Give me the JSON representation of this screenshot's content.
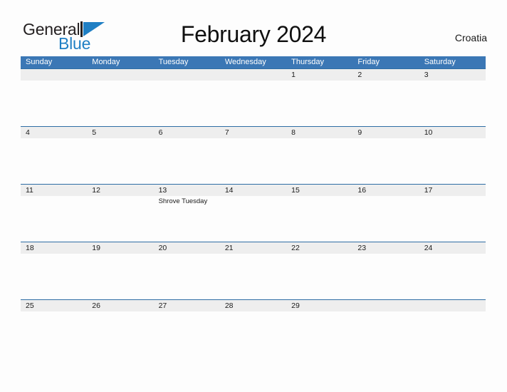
{
  "brand": {
    "name_top": "General",
    "name_bottom": "Blue",
    "flag_icon": "blue-triangle-flag-icon",
    "accent_color": "#1f7fc4"
  },
  "header": {
    "title": "February 2024",
    "country": "Croatia"
  },
  "colors": {
    "header_blue": "#3b77b5",
    "row_line_blue": "#2e6da4",
    "date_band_gray": "#eeeeee",
    "page_background": "#fdfdfd",
    "text": "#1a1a1a"
  },
  "calendar": {
    "month": "February",
    "year": "2024",
    "weekdays": [
      "Sunday",
      "Monday",
      "Tuesday",
      "Wednesday",
      "Thursday",
      "Friday",
      "Saturday"
    ],
    "weeks": [
      {
        "days": [
          {
            "num": "",
            "event": ""
          },
          {
            "num": "",
            "event": ""
          },
          {
            "num": "",
            "event": ""
          },
          {
            "num": "",
            "event": ""
          },
          {
            "num": "1",
            "event": ""
          },
          {
            "num": "2",
            "event": ""
          },
          {
            "num": "3",
            "event": ""
          }
        ]
      },
      {
        "days": [
          {
            "num": "4",
            "event": ""
          },
          {
            "num": "5",
            "event": ""
          },
          {
            "num": "6",
            "event": ""
          },
          {
            "num": "7",
            "event": ""
          },
          {
            "num": "8",
            "event": ""
          },
          {
            "num": "9",
            "event": ""
          },
          {
            "num": "10",
            "event": ""
          }
        ]
      },
      {
        "days": [
          {
            "num": "11",
            "event": ""
          },
          {
            "num": "12",
            "event": ""
          },
          {
            "num": "13",
            "event": "Shrove Tuesday"
          },
          {
            "num": "14",
            "event": ""
          },
          {
            "num": "15",
            "event": ""
          },
          {
            "num": "16",
            "event": ""
          },
          {
            "num": "17",
            "event": ""
          }
        ]
      },
      {
        "days": [
          {
            "num": "18",
            "event": ""
          },
          {
            "num": "19",
            "event": ""
          },
          {
            "num": "20",
            "event": ""
          },
          {
            "num": "21",
            "event": ""
          },
          {
            "num": "22",
            "event": ""
          },
          {
            "num": "23",
            "event": ""
          },
          {
            "num": "24",
            "event": ""
          }
        ]
      },
      {
        "days": [
          {
            "num": "25",
            "event": ""
          },
          {
            "num": "26",
            "event": ""
          },
          {
            "num": "27",
            "event": ""
          },
          {
            "num": "28",
            "event": ""
          },
          {
            "num": "29",
            "event": ""
          },
          {
            "num": "",
            "event": ""
          },
          {
            "num": "",
            "event": ""
          }
        ]
      }
    ]
  }
}
